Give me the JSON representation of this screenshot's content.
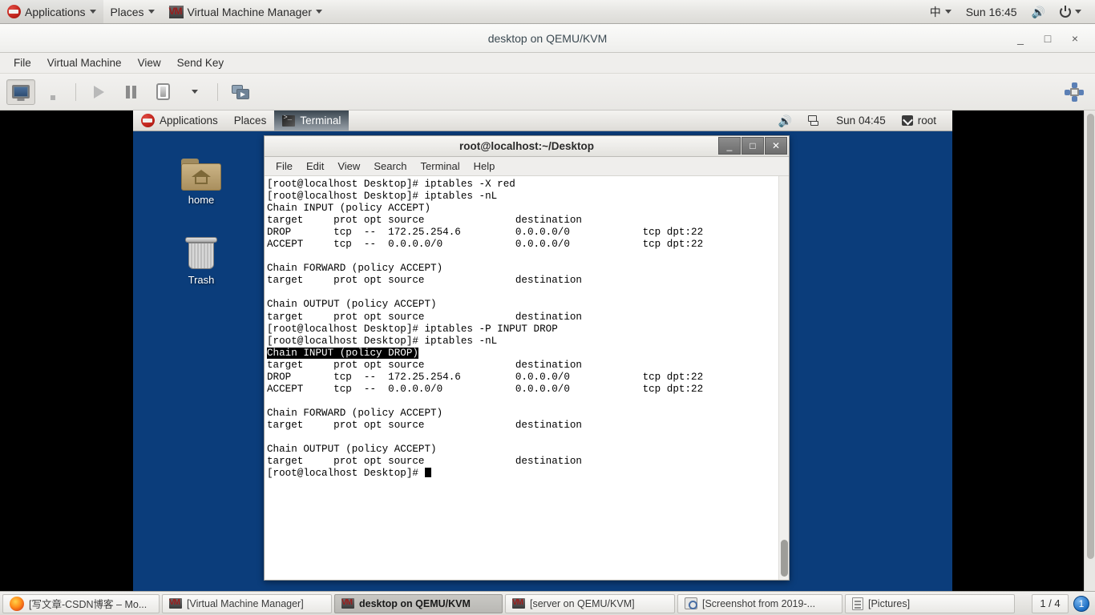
{
  "host_panel": {
    "applications_label": "Applications",
    "places_label": "Places",
    "app_menu_label": "Virtual Machine Manager",
    "ime_label": "中",
    "clock_label": "Sun 16:45"
  },
  "vm_window": {
    "title": "desktop on QEMU/KVM",
    "minimize_label": "_",
    "maximize_label": "□",
    "close_label": "×",
    "menus": [
      "File",
      "Virtual Machine",
      "View",
      "Send Key"
    ],
    "toolbar": {
      "console_label": "Show the graphical console",
      "details_label": "Show virtual hardware details",
      "run_label": "Run",
      "pause_label": "Pause",
      "shutdown_label": "Shut Down",
      "shutdown_menu_label": "Shut Down options",
      "snapshots_label": "Manage VM snapshots",
      "fullscreen_label": "Fullscreen"
    }
  },
  "guest_panel": {
    "applications_label": "Applications",
    "places_label": "Places",
    "window_label": "Terminal",
    "clock_label": "Sun 04:45",
    "user_label": "root"
  },
  "desktop_icons": [
    {
      "label": "home",
      "icon": "home-folder-icon"
    },
    {
      "label": "Trash",
      "icon": "trash-icon"
    }
  ],
  "terminal": {
    "title": "root@localhost:~/Desktop",
    "minimize_label": "_",
    "maximize_label": "□",
    "close_label": "✕",
    "menus": [
      "File",
      "Edit",
      "View",
      "Search",
      "Terminal",
      "Help"
    ],
    "lines": [
      {
        "text": "[root@localhost Desktop]# iptables -X red",
        "highlight": false
      },
      {
        "text": "[root@localhost Desktop]# iptables -nL",
        "highlight": false
      },
      {
        "text": "Chain INPUT (policy ACCEPT)",
        "highlight": false
      },
      {
        "text": "target     prot opt source               destination",
        "highlight": false
      },
      {
        "text": "DROP       tcp  --  172.25.254.6         0.0.0.0/0            tcp dpt:22",
        "highlight": false
      },
      {
        "text": "ACCEPT     tcp  --  0.0.0.0/0            0.0.0.0/0            tcp dpt:22",
        "highlight": false
      },
      {
        "text": "",
        "highlight": false
      },
      {
        "text": "Chain FORWARD (policy ACCEPT)",
        "highlight": false
      },
      {
        "text": "target     prot opt source               destination",
        "highlight": false
      },
      {
        "text": "",
        "highlight": false
      },
      {
        "text": "Chain OUTPUT (policy ACCEPT)",
        "highlight": false
      },
      {
        "text": "target     prot opt source               destination",
        "highlight": false
      },
      {
        "text": "[root@localhost Desktop]# iptables -P INPUT DROP",
        "highlight": false
      },
      {
        "text": "[root@localhost Desktop]# iptables -nL",
        "highlight": false
      },
      {
        "text": "Chain INPUT (policy DROP)",
        "highlight": true
      },
      {
        "text": "target     prot opt source               destination",
        "highlight": false
      },
      {
        "text": "DROP       tcp  --  172.25.254.6         0.0.0.0/0            tcp dpt:22",
        "highlight": false
      },
      {
        "text": "ACCEPT     tcp  --  0.0.0.0/0            0.0.0.0/0            tcp dpt:22",
        "highlight": false
      },
      {
        "text": "",
        "highlight": false
      },
      {
        "text": "Chain FORWARD (policy ACCEPT)",
        "highlight": false
      },
      {
        "text": "target     prot opt source               destination",
        "highlight": false
      },
      {
        "text": "",
        "highlight": false
      },
      {
        "text": "Chain OUTPUT (policy ACCEPT)",
        "highlight": false
      },
      {
        "text": "target     prot opt source               destination",
        "highlight": false
      }
    ],
    "prompt": "[root@localhost Desktop]# "
  },
  "taskbar": {
    "items": [
      {
        "label": "[写文章-CSDN博客 – Mo...",
        "icon": "firefox-icon",
        "active": false
      },
      {
        "label": "[Virtual Machine Manager]",
        "icon": "vmm-icon",
        "active": false
      },
      {
        "label": "desktop on QEMU/KVM",
        "icon": "vmm-icon",
        "active": true
      },
      {
        "label": "[server on QEMU/KVM]",
        "icon": "vmm-icon",
        "active": false
      },
      {
        "label": "[Screenshot from 2019-...",
        "icon": "screenshot-icon",
        "active": false
      },
      {
        "label": "[Pictures]",
        "icon": "pictures-icon",
        "active": false
      }
    ],
    "pager_label": "1 / 4",
    "workspace_badge": "1"
  },
  "colors": {
    "guest_desktop_blue": "#0b3d7b",
    "terminal_bg": "#ffffff",
    "terminal_fg": "#000000",
    "panel_gray": "#e6e5e2",
    "taskbar_active": "#c1c0bc"
  }
}
